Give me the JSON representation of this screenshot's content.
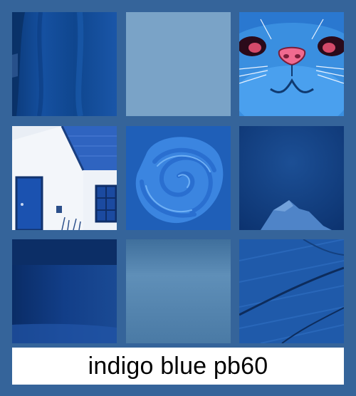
{
  "caption": "indigo blue pb60",
  "colors": {
    "background": "#35649a",
    "flat_swatch": "#7aa3c7",
    "caption_bg": "#ffffff",
    "caption_text": "#000000"
  },
  "tiles": [
    {
      "name": "fabric-tile",
      "icon": "folded-fabric-image"
    },
    {
      "name": "flat-swatch-tile",
      "icon": "flat-color-swatch"
    },
    {
      "name": "cat-face-tile",
      "icon": "blue-cat-illustration"
    },
    {
      "name": "cottage-tile",
      "icon": "white-cottage-illustration"
    },
    {
      "name": "swirl-tile",
      "icon": "paint-swirl-image"
    },
    {
      "name": "mountain-tile",
      "icon": "dark-mountain-image"
    },
    {
      "name": "mug-tile",
      "icon": "dark-blue-mug-image"
    },
    {
      "name": "gradient-tile",
      "icon": "gradient-swatch"
    },
    {
      "name": "wood-tile",
      "icon": "blue-wood-texture"
    }
  ]
}
